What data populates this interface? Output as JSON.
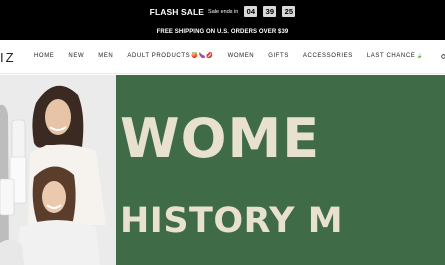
{
  "flash": {
    "title": "FLASH SALE",
    "subtitle": "Sale ends in",
    "countdown": [
      "04",
      "39",
      "25"
    ]
  },
  "shipping": {
    "text": "FREE SHIPPING ON U.S. ORDERS OVER $39"
  },
  "nav": {
    "logo": "IZ",
    "items": [
      "HOME",
      "NEW",
      "MEN",
      "ADULT PRODUCTS",
      "WOMEN",
      "GIFTS",
      "ACCESSORIES",
      "LAST CHANCE"
    ],
    "adult_emojis": "🍑🍆💋",
    "last_chance_emoji": "🍃"
  },
  "hero": {
    "line1": "WOME",
    "line2": "HISTORY M"
  }
}
